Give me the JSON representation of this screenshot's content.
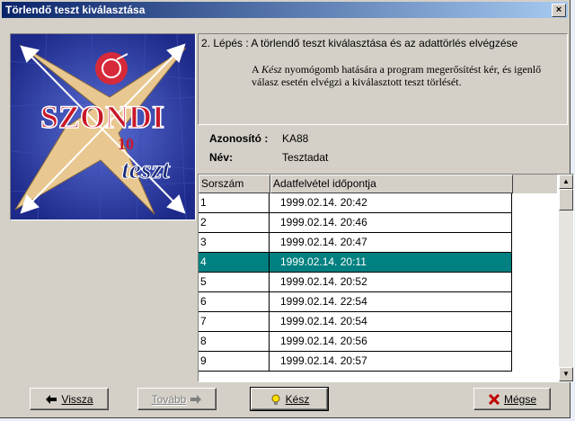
{
  "window": {
    "title": "Törlendő teszt kiválasztása",
    "close_label": "×"
  },
  "logo": {
    "alt": "SZONDI 10 teszt"
  },
  "step": {
    "title": "2. Lépés : A törlendő teszt kiválasztása és az adattörlés elvégzése",
    "desc_pre": "A ",
    "desc_em": "Kész",
    "desc_post": " nyomógomb hatására a program megerősítést kér, és igenlő válasz esetén elvégzi a kiválasztott teszt törlését."
  },
  "info": {
    "id_label": "Azonosító :",
    "id_value": "KA88",
    "name_label": "Név:",
    "name_value": "Tesztadat"
  },
  "grid": {
    "columns": [
      "Sorszám",
      "Adatfelvétel időpontja"
    ],
    "rows": [
      {
        "no": "1",
        "time": "1999.02.14. 20:42"
      },
      {
        "no": "2",
        "time": "1999.02.14. 20:46"
      },
      {
        "no": "3",
        "time": "1999.02.14. 20:47"
      },
      {
        "no": "4",
        "time": "1999.02.14. 20:11"
      },
      {
        "no": "5",
        "time": "1999.02.14. 20:52"
      },
      {
        "no": "6",
        "time": "1999.02.14. 22:54"
      },
      {
        "no": "7",
        "time": "1999.02.14. 20:54"
      },
      {
        "no": "8",
        "time": "1999.02.14. 20:56"
      },
      {
        "no": "9",
        "time": "1999.02.14. 20:57"
      }
    ],
    "selected_row": "4"
  },
  "buttons": {
    "back": "Vissza",
    "next": "Tovább",
    "done": "Kész",
    "cancel": "Mégse"
  },
  "colors": {
    "selection": "#008080",
    "title_bar": "#0a246a",
    "face": "#d4d0c8"
  }
}
